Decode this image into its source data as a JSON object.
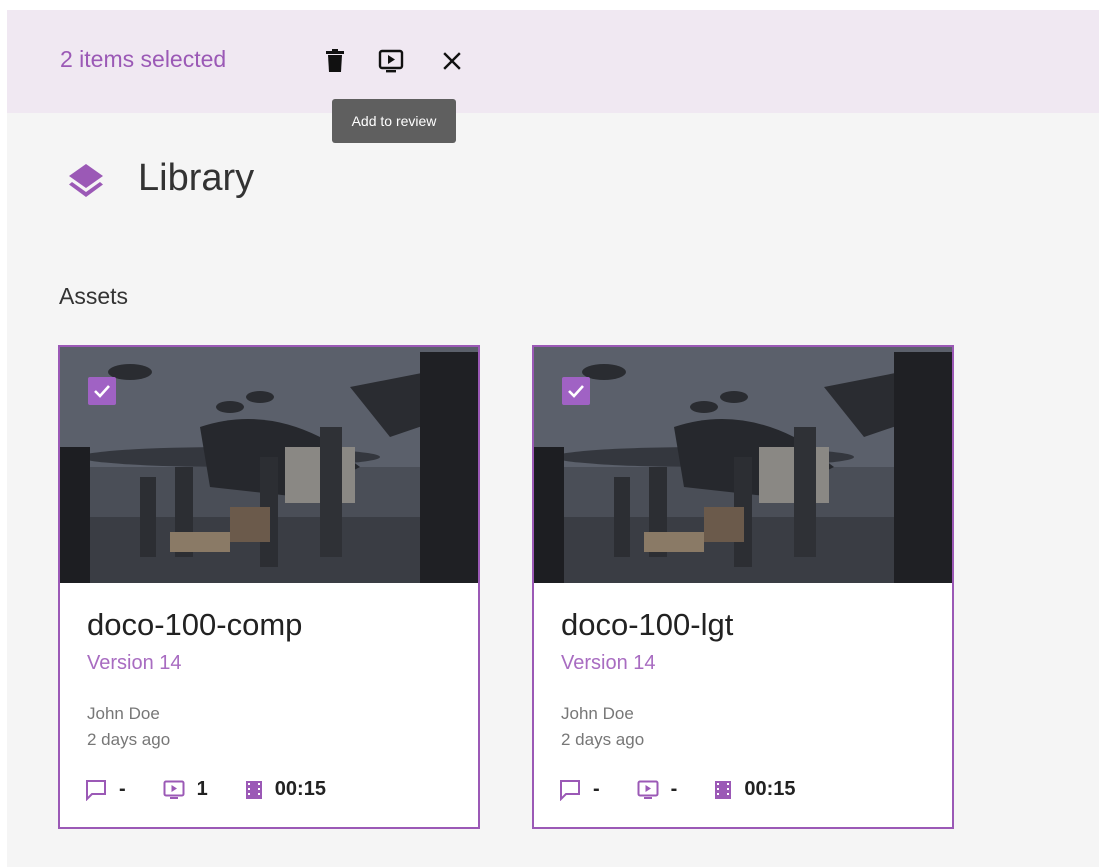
{
  "selection_bar": {
    "count_label": "2 items selected",
    "tooltip": "Add to review",
    "icons": [
      "delete-icon",
      "add-to-review-icon",
      "close-icon"
    ]
  },
  "library": {
    "title": "Library",
    "section_label": "Assets"
  },
  "assets": [
    {
      "name": "doco-100-comp",
      "version": "Version 14",
      "author": "John Doe",
      "time": "2 days ago",
      "comments": "-",
      "reviews": "1",
      "duration": "00:15",
      "selected": true
    },
    {
      "name": "doco-100-lgt",
      "version": "Version 14",
      "author": "John Doe",
      "time": "2 days ago",
      "comments": "-",
      "reviews": "-",
      "duration": "00:15",
      "selected": true
    }
  ],
  "colors": {
    "accent": "#9b59b6",
    "selection_bar_bg": "#f0e8f2",
    "page_bg": "#f5f5f5"
  }
}
